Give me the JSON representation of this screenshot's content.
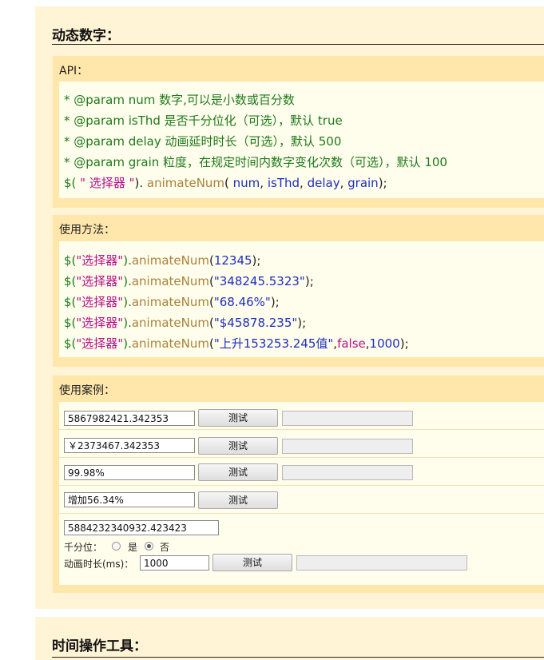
{
  "header": {
    "title": "动态数字："
  },
  "api": {
    "heading": "API：",
    "lines": [
      "* @param num 数字,可以是小数或百分数",
      "* @param isThd 是否千分位化（可选），默认 true",
      "* @param delay 动画延时时长（可选），默认 500",
      "* @param grain 粒度，在规定时间内数字变化次数（可选），默认 100"
    ],
    "signature": {
      "prefix": "$(",
      "selector": " \" 选择器 \"",
      "close": ").",
      "method": " animateNum",
      "open": "(",
      "args": [
        " num",
        " isThd",
        " delay",
        " grain"
      ],
      "separator": ",",
      "end": ");"
    }
  },
  "usage": {
    "heading": "使用方法：",
    "examples": [
      {
        "selector": "\"选择器\"",
        "args": "12345",
        "tail": ""
      },
      {
        "selector": "\"选择器\"",
        "args": "\"348245.5323\"",
        "tail": ""
      },
      {
        "selector": "\"选择器\"",
        "args": "\"68.46%\"",
        "tail": ""
      },
      {
        "selector": "\"选择器\"",
        "args": "\"$45878.235\"",
        "tail": ""
      },
      {
        "selector": "\"选择器\"",
        "args": "\"上升153253.245值\"",
        "flag": "false",
        "num": "1000"
      }
    ],
    "prefix": "$(",
    "mid": ").",
    "method": "animateNum",
    "open": "(",
    "comma": ",",
    "end": ");"
  },
  "cases": {
    "heading": "使用案例：",
    "rows": [
      {
        "value": "5867982421.342353",
        "button": "测试"
      },
      {
        "value": "￥2373467.342353",
        "button": "测试"
      },
      {
        "value": "99.98%",
        "button": "测试"
      },
      {
        "value": "增加56.34%",
        "button": "测试"
      }
    ],
    "advanced": {
      "value": "5884232340932.423423",
      "thousands_label": "千分位：",
      "yes_label": "是",
      "no_label": "否",
      "selected": "no",
      "duration_label": "动画时长(ms)：",
      "duration_value": "1000",
      "button": "测试"
    }
  },
  "next_section": {
    "title": "时间操作工具："
  }
}
